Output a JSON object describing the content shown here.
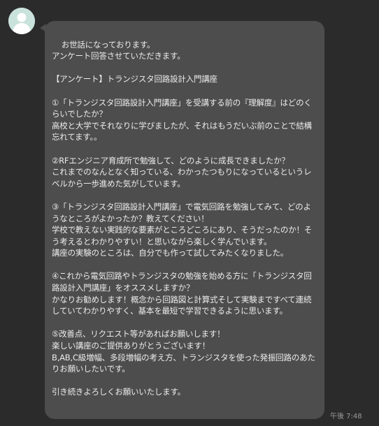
{
  "message": {
    "text": "お世話になっております。\nアンケート回答させていただきます。\n\n【アンケート】トランジスタ回路設計入門講座\n\n①「トランジスタ回路設計入門講座」を受講する前の『理解度』はどのくらいでしたか？\n高校と大学でそれなりに学びましたが、それはもうだいぶ前のことで結構忘れてます。。\n\n②RFエンジニア育成所で勉強して、どのように成長できましたか？\nこれまでのなんとなく知っている、わかったつもりになっているというレベルから一歩進めた気がしています。\n\n③「トランジスタ回路設計入門講座」で電気回路を勉強してみて、どのようなところがよかったか？教えてください！\n学校で教えない実践的な要素がところどころにあり、そうだったのか！そう考えるとわかりやすい！と思いながら楽しく学んでいます。\n講座の実験のところは、自分でも作って試してみたくなりました。\n\n④これから電気回路やトランジスタの勉強を始める方に「トランジスタ回路設計入門講座」をオススメしますか？\nかなりお勧めします！概念から回路図と計算式そして実験まですべて連続していてわかりやすく、基本を最短で学習できるように思います。\n\n⑤改善点、リクエスト等があればお願いします！\n楽しい講座のご提供ありがとうございます！\nB,AB,C級増幅、多段増幅の考え方、トランジスタを使った発振回路のあたりお願いしたいです。\n\n引き続きよろしくお願いいたします。",
    "time": "午後 7:48"
  },
  "icons": {
    "avatar": "default-user-avatar-icon"
  },
  "colors": {
    "background": "#2b2b2b",
    "bubble": "#4d4d4d",
    "text": "#ececec",
    "avatar_bg": "#c9e2dc",
    "timestamp": "#9a9a9a"
  }
}
